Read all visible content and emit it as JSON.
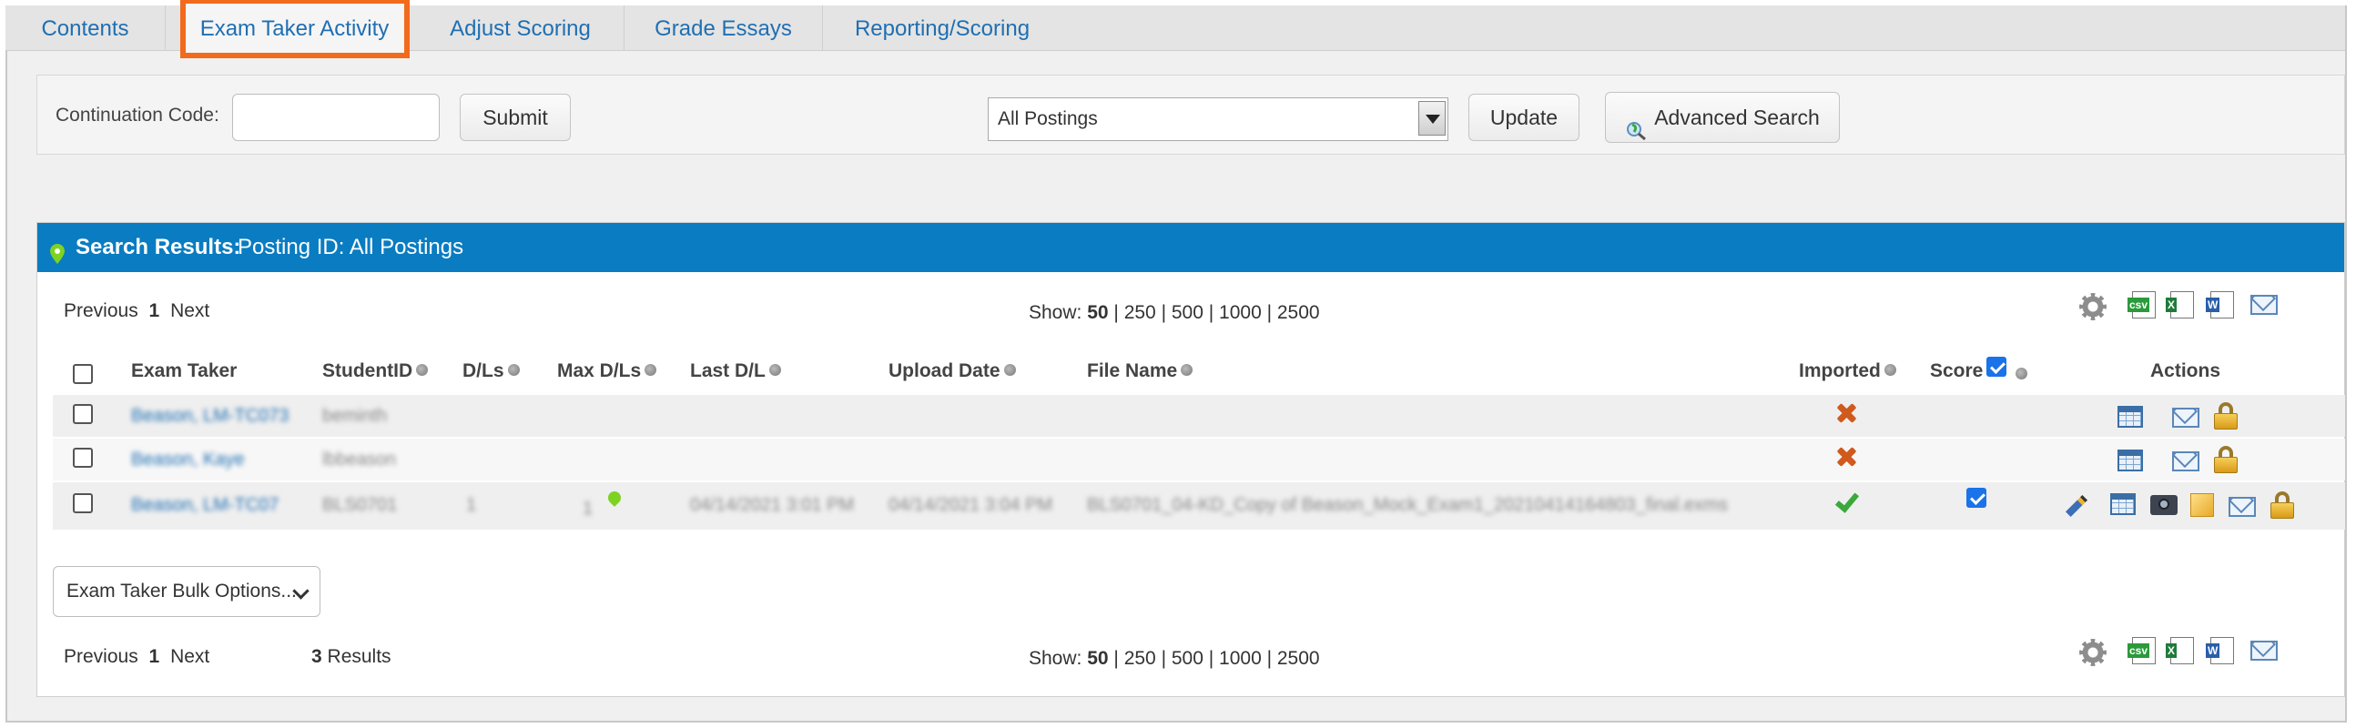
{
  "tabs": [
    {
      "label": "Contents"
    },
    {
      "label": "Exam Taker Activity"
    },
    {
      "label": "Adjust Scoring"
    },
    {
      "label": "Grade Essays"
    },
    {
      "label": "Reporting/Scoring"
    }
  ],
  "search": {
    "continuation_label": "Continuation Code:",
    "continuation_value": "",
    "submit_label": "Submit",
    "postings_selected": "All Postings",
    "update_label": "Update",
    "advanced_label": "Advanced Search"
  },
  "results": {
    "header_label": "Search Results:",
    "header_value": "Posting ID: All Postings",
    "previous_label": "Previous",
    "page_number": "1",
    "next_label": "Next",
    "show_label": "Show:",
    "show_current": "50",
    "show_rest": " | 250 | 500 | 1000 | 2500",
    "count": "3",
    "count_label": "Results",
    "bulk_options": "Exam Taker Bulk Options...",
    "export_icons": [
      "gear-icon",
      "csv-icon",
      "excel-icon",
      "word-icon",
      "mail-icon"
    ]
  },
  "columns": {
    "exam_taker": "Exam Taker",
    "student_id": "StudentID",
    "dls": "D/Ls",
    "max_dls": "Max D/Ls",
    "last_dl": "Last D/L",
    "upload_date": "Upload Date",
    "file_name": "File Name",
    "imported": "Imported",
    "score": "Score",
    "actions": "Actions"
  },
  "rows": [
    {
      "name": "Beason, LM-TC073",
      "student_id": "beminth",
      "dls": "",
      "max_dls": "",
      "last_dl": "",
      "upload_date": "",
      "file_name": "",
      "imported": "no",
      "score_checked": false
    },
    {
      "name": "Beason, Kaye",
      "student_id": "lbbeason",
      "dls": "",
      "max_dls": "",
      "last_dl": "",
      "upload_date": "",
      "file_name": "",
      "imported": "no",
      "score_checked": false
    },
    {
      "name": "Beason, LM-TC07",
      "student_id": "BLS0701",
      "dls": "1",
      "max_dls": "1",
      "last_dl": "04/14/2021 3:01 PM",
      "upload_date": "04/14/2021 3:04 PM",
      "file_name": "BLS0701_04-KD_Copy of Beason_Mock_Exam1_20210414164803_final.exms",
      "imported": "yes",
      "score_checked": true
    }
  ],
  "colors": {
    "accent": "#0a7cc1",
    "link": "#1f6fb2",
    "highlight": "#f26a1b"
  }
}
